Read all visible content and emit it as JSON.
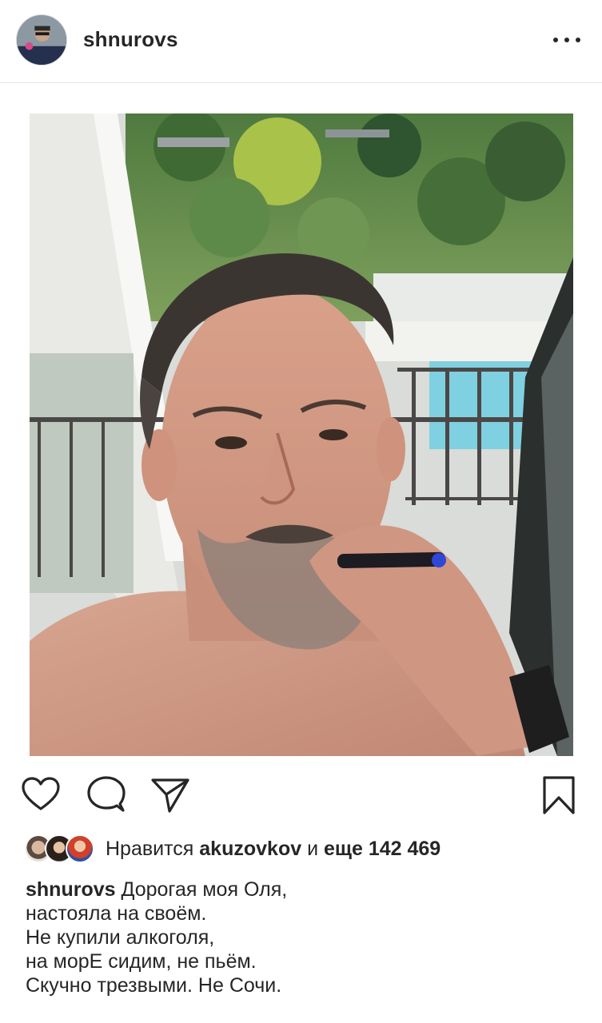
{
  "post": {
    "username": "shnurovs",
    "more_icon": "more-horizontal-icon"
  },
  "actions": {
    "like_icon": "heart-icon",
    "comment_icon": "comment-icon",
    "share_icon": "send-icon",
    "save_icon": "bookmark-icon"
  },
  "likes": {
    "prefix": "Нравится",
    "user": "akuzovkov",
    "conj": "и",
    "rest": "еще 142 469"
  },
  "caption": {
    "username": "shnurovs",
    "lines": [
      "Дорогая моя Оля,",
      "настояла на своём.",
      "Не купили алкоголя,",
      "на морЕ сидим, не пьём.",
      "Скучно трезвыми. Не Сочи."
    ]
  }
}
